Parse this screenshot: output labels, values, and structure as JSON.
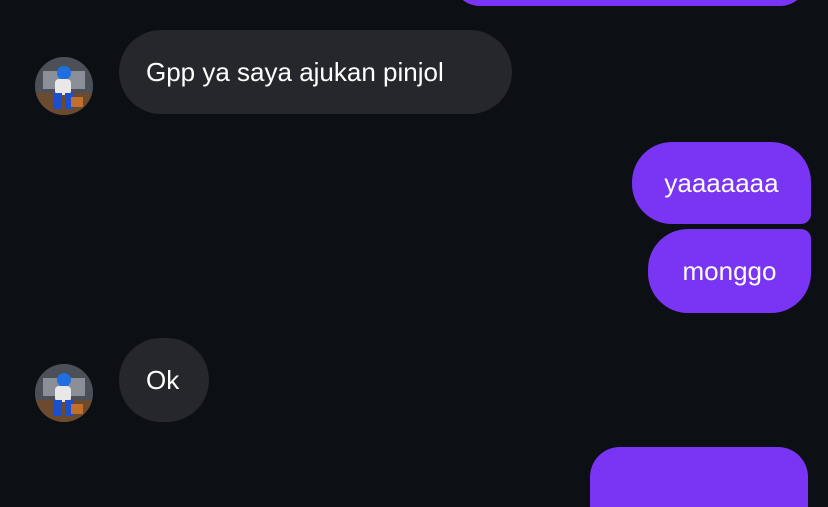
{
  "conversation": {
    "messages": [
      {
        "direction": "outgoing",
        "text": ""
      },
      {
        "direction": "incoming",
        "text": "Gpp ya saya ajukan pinjol",
        "avatar_icon": "user-avatar-icon"
      },
      {
        "direction": "outgoing",
        "text": "yaaaaaaa"
      },
      {
        "direction": "outgoing",
        "text": "monggo"
      },
      {
        "direction": "incoming",
        "text": "Ok",
        "avatar_icon": "user-avatar-icon"
      },
      {
        "direction": "outgoing",
        "text": ""
      }
    ]
  },
  "colors": {
    "background": "#0c0f14",
    "incoming_bubble": "#25272c",
    "outgoing_bubble": "#7a35f4",
    "text": "#ffffff"
  }
}
